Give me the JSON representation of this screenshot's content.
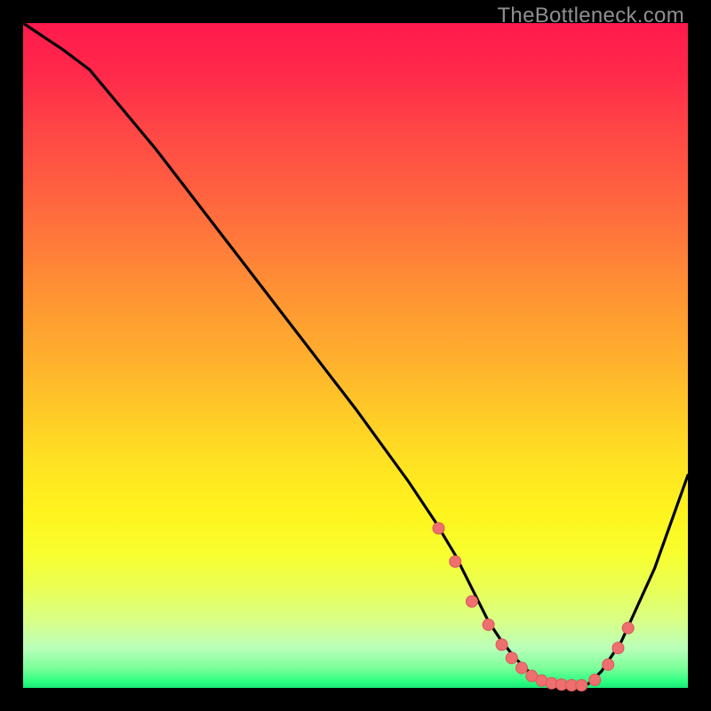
{
  "watermark": "TheBottleneck.com",
  "colors": {
    "frame": "#000000",
    "gradient_top": "#ff1a4d",
    "gradient_bottom": "#18e878",
    "curve": "#000000",
    "marker_fill": "#ef6e6e",
    "marker_stroke": "#d85a5a"
  },
  "chart_data": {
    "type": "line",
    "title": "",
    "xlabel": "",
    "ylabel": "",
    "xlim": [
      0,
      100
    ],
    "ylim": [
      0,
      100
    ],
    "series": [
      {
        "name": "bottleneck-curve",
        "x": [
          0,
          6,
          10,
          20,
          30,
          40,
          50,
          58,
          62,
          65,
          68,
          70,
          72,
          74,
          76,
          78,
          80,
          82,
          83.5,
          85,
          87,
          90,
          95,
          100
        ],
        "y": [
          100,
          96,
          93,
          81,
          68,
          55,
          42,
          31,
          25,
          20,
          14,
          10,
          7,
          4.5,
          2.5,
          1.3,
          0.6,
          0.4,
          0.4,
          0.6,
          2.5,
          7,
          18,
          32
        ]
      }
    ],
    "markers": {
      "name": "highlight-points",
      "x": [
        62.5,
        65,
        67.5,
        70,
        72,
        73.5,
        75,
        76.5,
        78,
        79.5,
        81,
        82.5,
        84,
        86,
        88,
        89.5,
        91
      ],
      "y": [
        24,
        19,
        13,
        9.5,
        6.5,
        4.5,
        3,
        1.8,
        1.1,
        0.7,
        0.5,
        0.4,
        0.4,
        1.2,
        3.5,
        6,
        9
      ]
    }
  }
}
